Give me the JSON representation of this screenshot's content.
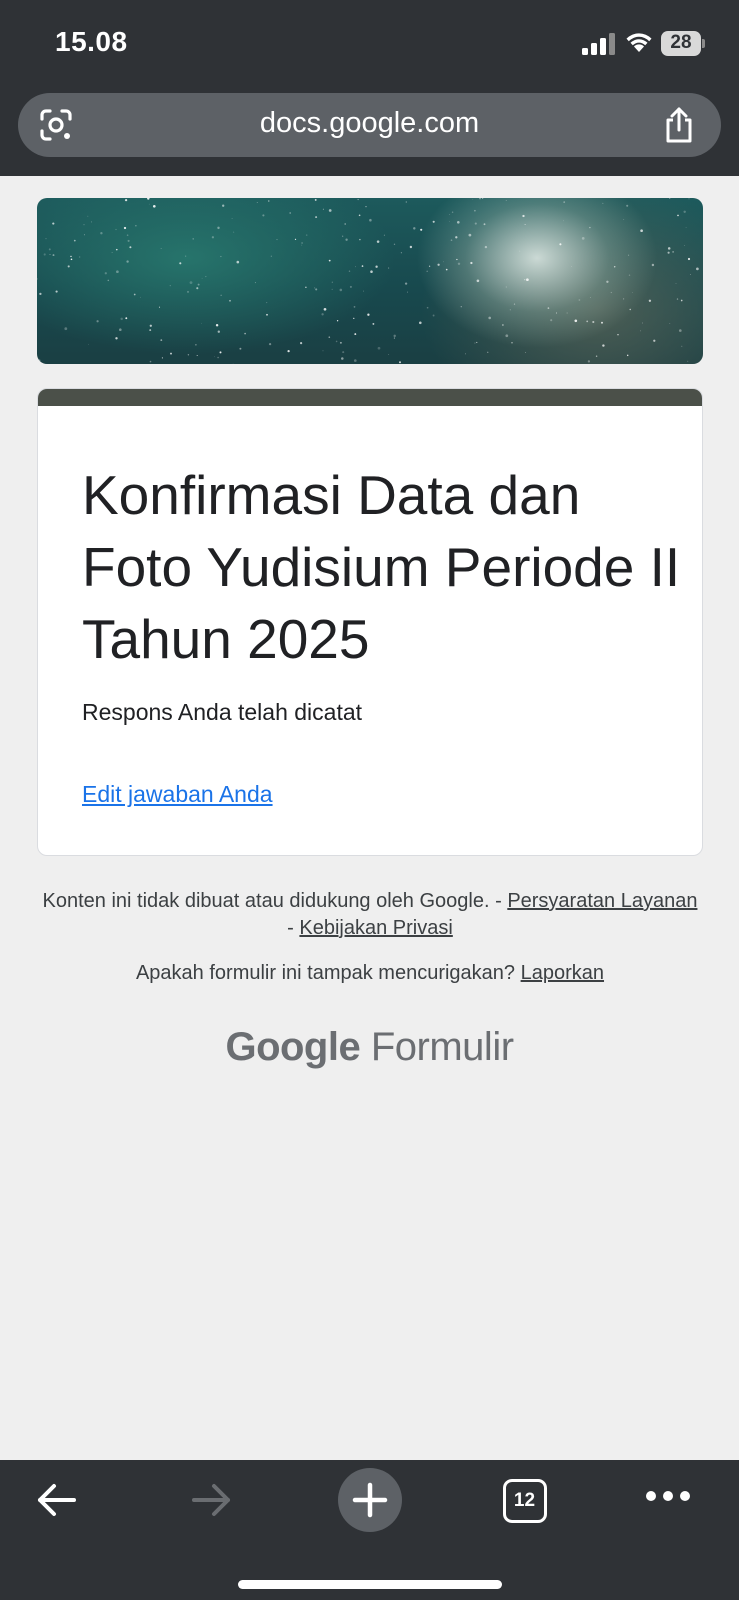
{
  "status_bar": {
    "time": "15.08",
    "battery_level": "28"
  },
  "browser": {
    "url": "docs.google.com",
    "tab_count": "12",
    "icons": {
      "lens": "google-lens-icon",
      "share": "share-icon",
      "back": "back-arrow-icon",
      "forward": "forward-arrow-icon",
      "new_tab": "plus-icon",
      "tabs": "tab-switcher-icon",
      "more": "more-dots-icon"
    }
  },
  "form": {
    "title": "Konfirmasi Data dan Foto Yudisium Periode II Tahun 2025",
    "confirmation_message": "Respons Anda telah dicatat",
    "edit_link": "Edit jawaban Anda",
    "accent_color": "#4b5049"
  },
  "footer": {
    "disclaimer": "Konten ini tidak dibuat atau didukung oleh Google. -",
    "terms_link": "Persyaratan Layanan",
    "separator": "-",
    "privacy_link": "Kebijakan Privasi",
    "report_prompt": "Apakah formulir ini tampak mencurigakan?",
    "report_link": "Laporkan",
    "brand_google": "Google",
    "brand_product": "Formulir"
  }
}
